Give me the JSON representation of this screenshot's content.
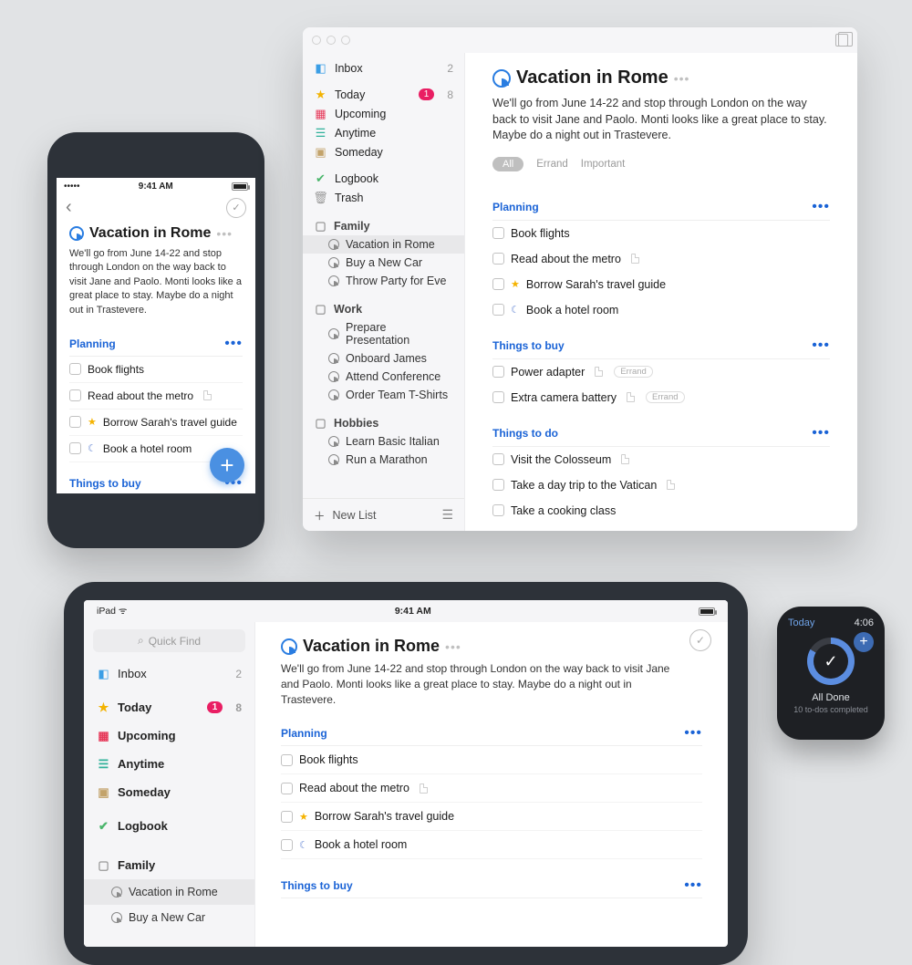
{
  "status": {
    "time": "9:41 AM",
    "ipad_left": "iPad",
    "signal": "•••••"
  },
  "project": {
    "title": "Vacation in Rome",
    "description": "We'll go from June 14-22 and stop through London on the way back to visit Jane and Paolo. Monti looks like a great place to stay. Maybe do a night out in Trastevere."
  },
  "filters": {
    "all": "All",
    "errand": "Errand",
    "important": "Important"
  },
  "sections": {
    "planning": {
      "title": "Planning",
      "items": [
        {
          "label": "Book flights"
        },
        {
          "label": "Read about the metro",
          "note": true
        },
        {
          "label": "Borrow Sarah's travel guide",
          "star": true
        },
        {
          "label": "Book a hotel room",
          "moon": true
        }
      ]
    },
    "buy": {
      "title": "Things to buy",
      "items": [
        {
          "label": "Power adapter",
          "note": true,
          "tag": "Errand"
        },
        {
          "label": "Extra camera battery",
          "note": true,
          "tag": "Errand"
        }
      ]
    },
    "do": {
      "title": "Things to do",
      "items": [
        {
          "label": "Visit the Colosseum",
          "note": true
        },
        {
          "label": "Take a day trip to the Vatican",
          "note": true
        },
        {
          "label": "Take a cooking class"
        }
      ]
    }
  },
  "sidebar": {
    "inbox": {
      "label": "Inbox",
      "count": "2"
    },
    "today": {
      "label": "Today",
      "badge": "1",
      "count": "8"
    },
    "upcoming": {
      "label": "Upcoming"
    },
    "anytime": {
      "label": "Anytime"
    },
    "someday": {
      "label": "Someday"
    },
    "logbook": {
      "label": "Logbook"
    },
    "trash": {
      "label": "Trash"
    },
    "areas": {
      "family": {
        "label": "Family",
        "projects": [
          "Vacation in Rome",
          "Buy a New Car",
          "Throw Party for Eve"
        ]
      },
      "work": {
        "label": "Work",
        "projects": [
          "Prepare Presentation",
          "Onboard James",
          "Attend Conference",
          "Order Team T-Shirts"
        ]
      },
      "hobbies": {
        "label": "Hobbies",
        "projects": [
          "Learn Basic Italian",
          "Run a Marathon"
        ]
      }
    },
    "newlist": "New List",
    "quickfind": "Quick Find"
  },
  "watch": {
    "label": "Today",
    "time": "4:06",
    "title": "All Done",
    "subtitle": "10 to-dos completed"
  }
}
